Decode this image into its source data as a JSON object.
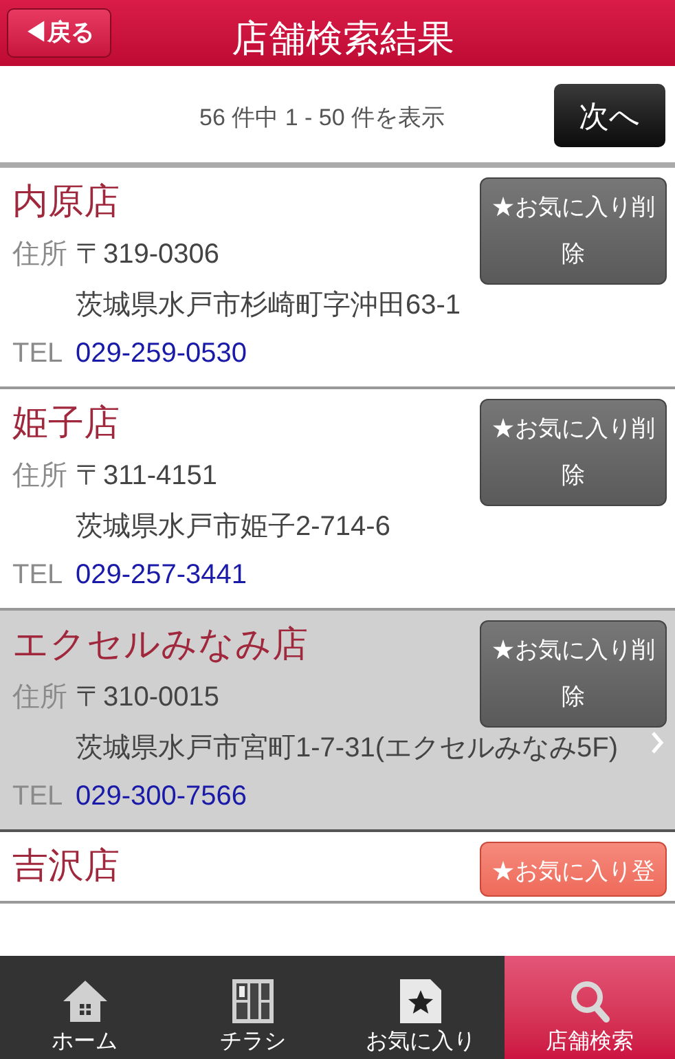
{
  "header": {
    "back": "◀戻る",
    "title": "店舗検索結果"
  },
  "pager": {
    "summary": "56 件中 1 - 50 件を表示",
    "next": "次へ"
  },
  "stores": [
    {
      "name": "内原店",
      "address_label": "住所",
      "postal": "〒319-0306",
      "address": "茨城県水戸市杉崎町字沖田63-1",
      "tel_label": "TEL",
      "tel": "029-259-0530",
      "favorite": true,
      "button": "★お気に入り削除",
      "selected": false
    },
    {
      "name": "姫子店",
      "address_label": "住所",
      "postal": "〒311-4151",
      "address": "茨城県水戸市姫子2-714-6",
      "tel_label": "TEL",
      "tel": "029-257-3441",
      "favorite": true,
      "button": "★お気に入り削除",
      "selected": false
    },
    {
      "name": "エクセルみなみ店",
      "address_label": "住所",
      "postal": "〒310-0015",
      "address": "茨城県水戸市宮町1-7-31(エクセルみなみ5F)",
      "tel_label": "TEL",
      "tel": "029-300-7566",
      "favorite": true,
      "button": "★お気に入り削除",
      "selected": true
    },
    {
      "name": "吉沢店",
      "favorite": false,
      "button": "★お気に入り登",
      "selected": false
    }
  ],
  "nav": [
    {
      "kind": "home",
      "label": "ホーム",
      "selected": false
    },
    {
      "kind": "flyer",
      "label": "チラシ",
      "selected": false
    },
    {
      "kind": "favorite",
      "label": "お気に入り",
      "selected": false
    },
    {
      "kind": "search",
      "label": "店舗検索",
      "selected": true
    }
  ]
}
